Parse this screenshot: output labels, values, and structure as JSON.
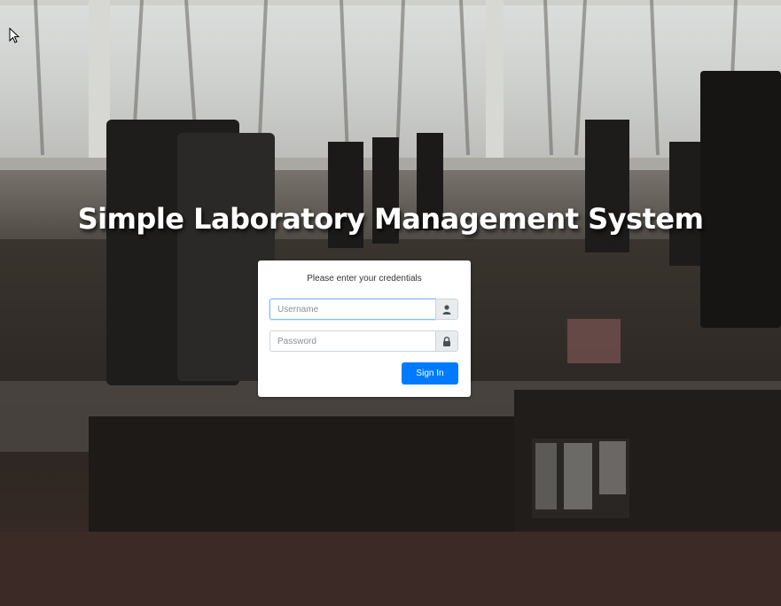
{
  "header": {
    "title": "Simple Laboratory Management System"
  },
  "login": {
    "message": "Please enter your credentials",
    "username": {
      "value": "",
      "placeholder": "Username",
      "icon": "user-icon"
    },
    "password": {
      "value": "",
      "placeholder": "Password",
      "icon": "lock-icon"
    },
    "submit_label": "Sign In"
  },
  "colors": {
    "accent": "#007bff",
    "card_background": "#ffffff",
    "addon_background": "#e9ecef"
  }
}
